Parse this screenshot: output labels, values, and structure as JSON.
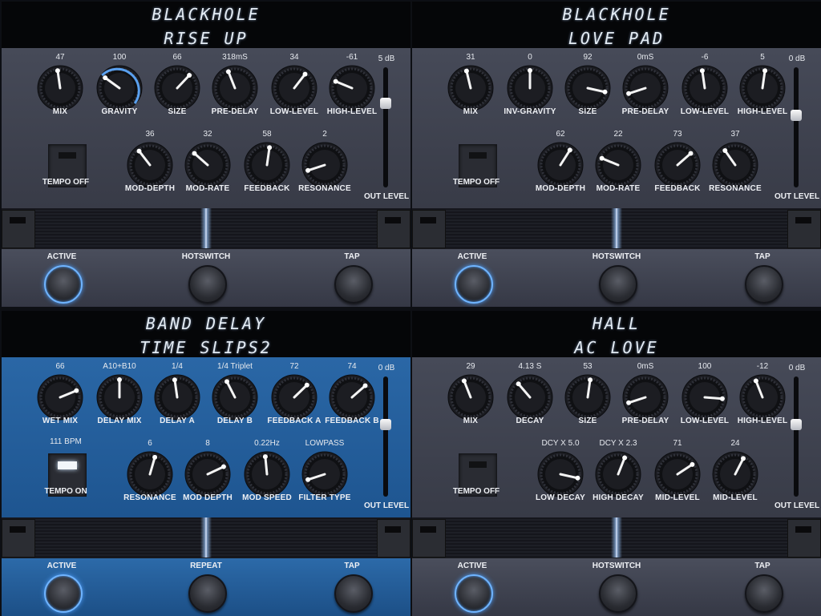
{
  "colors": {
    "panel_gray": "#3b3e4b",
    "panel_blue": "#1d4d7e",
    "led_blue": "#6fb4ff",
    "arc_blue": "#5aa0ef"
  },
  "pedals": [
    {
      "theme": "gray",
      "name": "BLACKHOLE",
      "preset": "RISE UP",
      "top_knobs": [
        {
          "value": "47",
          "label": "MIX",
          "level": 0.47
        },
        {
          "value": "100",
          "label": "GRAVITY",
          "level": 0.3,
          "arc": true
        },
        {
          "value": "66",
          "label": "SIZE",
          "level": 0.66
        },
        {
          "value": "318mS",
          "label": "PRE-DELAY",
          "level": 0.42
        },
        {
          "value": "34",
          "label": "LOW-LEVEL",
          "level": 0.64
        },
        {
          "value": "-61",
          "label": "HIGH-LEVEL",
          "level": 0.25
        }
      ],
      "tempo": {
        "value": "",
        "label": "TEMPO OFF",
        "on": false
      },
      "bottom_knobs": [
        {
          "value": "36",
          "label": "MOD-DEPTH",
          "level": 0.36
        },
        {
          "value": "32",
          "label": "MOD-RATE",
          "level": 0.32
        },
        {
          "value": "58",
          "label": "FEEDBACK",
          "level": 0.53
        },
        {
          "value": "2",
          "label": "RESONANCE",
          "level": 0.1
        }
      ],
      "out_level": {
        "value": "5 dB",
        "label": "OUT LEVEL",
        "level": 0.7
      },
      "switches": [
        {
          "label": "ACTIVE",
          "lit": true
        },
        {
          "label": "HOTSWITCH",
          "lit": false
        },
        {
          "label": "TAP",
          "lit": false
        }
      ]
    },
    {
      "theme": "gray",
      "name": "BLACKHOLE",
      "preset": "LOVE PAD",
      "top_knobs": [
        {
          "value": "31",
          "label": "MIX",
          "level": 0.45
        },
        {
          "value": "0",
          "label": "INV-GRAVITY",
          "level": 0.5
        },
        {
          "value": "92",
          "label": "SIZE",
          "level": 0.88
        },
        {
          "value": "0mS",
          "label": "PRE-DELAY",
          "level": 0.1
        },
        {
          "value": "-6",
          "label": "LOW-LEVEL",
          "level": 0.47
        },
        {
          "value": "5",
          "label": "HIGH-LEVEL",
          "level": 0.53
        }
      ],
      "tempo": {
        "value": "",
        "label": "TEMPO OFF",
        "on": false
      },
      "bottom_knobs": [
        {
          "value": "62",
          "label": "MOD-DEPTH",
          "level": 0.62
        },
        {
          "value": "22",
          "label": "MOD-RATE",
          "level": 0.25
        },
        {
          "value": "73",
          "label": "FEEDBACK",
          "level": 0.68
        },
        {
          "value": "37",
          "label": "RESONANCE",
          "level": 0.37
        }
      ],
      "out_level": {
        "value": "0 dB",
        "label": "OUT LEVEL",
        "level": 0.6
      },
      "switches": [
        {
          "label": "ACTIVE",
          "lit": true
        },
        {
          "label": "HOTSWITCH",
          "lit": false
        },
        {
          "label": "TAP",
          "lit": false
        }
      ]
    },
    {
      "theme": "blue",
      "name": "BAND DELAY",
      "preset": "TIME SLIPS2",
      "top_knobs": [
        {
          "value": "66",
          "label": "WET MIX",
          "level": 0.75
        },
        {
          "value": "A10+B10",
          "label": "DELAY MIX",
          "level": 0.5
        },
        {
          "value": "1/4",
          "label": "DELAY A",
          "level": 0.47
        },
        {
          "value": "1/4 Triplet",
          "label": "DELAY B",
          "level": 0.4
        },
        {
          "value": "72",
          "label": "FEEDBACK A",
          "level": 0.67
        },
        {
          "value": "74",
          "label": "FEEDBACK B",
          "level": 0.68
        }
      ],
      "tempo": {
        "value": "111 BPM",
        "label": "TEMPO ON",
        "on": true
      },
      "bottom_knobs": [
        {
          "value": "6",
          "label": "RESONANCE",
          "level": 0.56
        },
        {
          "value": "8",
          "label": "MOD DEPTH",
          "level": 0.74
        },
        {
          "value": "0.22Hz",
          "label": "MOD SPEED",
          "level": 0.48
        },
        {
          "value": "LOWPASS",
          "label": "FILTER TYPE",
          "level": 0.1
        }
      ],
      "out_level": {
        "value": "0 dB",
        "label": "OUT LEVEL",
        "level": 0.6
      },
      "switches": [
        {
          "label": "ACTIVE",
          "lit": true
        },
        {
          "label": "REPEAT",
          "lit": false
        },
        {
          "label": "TAP",
          "lit": false
        }
      ]
    },
    {
      "theme": "gray",
      "name": "HALL",
      "preset": "AC LOVE",
      "top_knobs": [
        {
          "value": "29",
          "label": "MIX",
          "level": 0.42
        },
        {
          "value": "4.13 S",
          "label": "DECAY",
          "level": 0.35
        },
        {
          "value": "53",
          "label": "SIZE",
          "level": 0.53
        },
        {
          "value": "0mS",
          "label": "PRE-DELAY",
          "level": 0.1
        },
        {
          "value": "100",
          "label": "LOW-LEVEL",
          "level": 0.85
        },
        {
          "value": "-12",
          "label": "HIGH-LEVEL",
          "level": 0.42
        }
      ],
      "tempo": {
        "value": "",
        "label": "TEMPO OFF",
        "on": false
      },
      "bottom_knobs": [
        {
          "value": "DCY X 5.0",
          "label": "LOW DECAY",
          "level": 0.88
        },
        {
          "value": "DCY X 2.3",
          "label": "HIGH DECAY",
          "level": 0.58
        },
        {
          "value": "71",
          "label": "MID-LEVEL",
          "level": 0.71
        },
        {
          "value": "24",
          "label": "MID-LEVEL",
          "level": 0.6
        }
      ],
      "out_level": {
        "value": "0 dB",
        "label": "OUT LEVEL",
        "level": 0.6
      },
      "switches": [
        {
          "label": "ACTIVE",
          "lit": true
        },
        {
          "label": "HOTSWITCH",
          "lit": false
        },
        {
          "label": "TAP",
          "lit": false
        }
      ]
    }
  ]
}
